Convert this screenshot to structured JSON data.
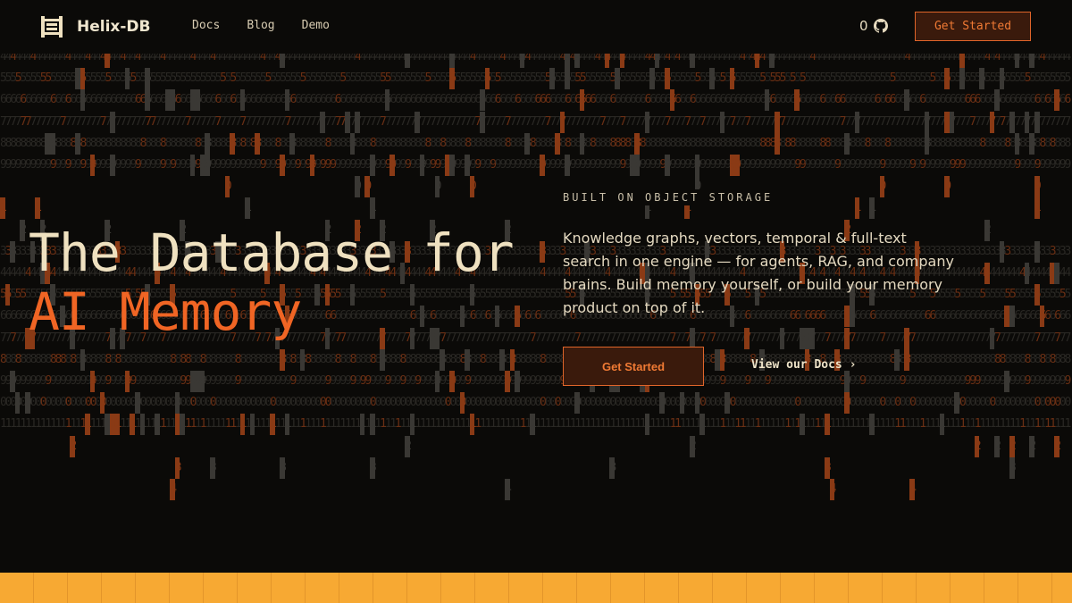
{
  "brand": {
    "name": "Helix-DB",
    "logo_icon": "helix-logo-icon"
  },
  "nav": {
    "items": [
      "Docs",
      "Blog",
      "Demo"
    ]
  },
  "github": {
    "stars": "0",
    "icon": "github-icon"
  },
  "header_cta": {
    "label": "Get Started"
  },
  "hero": {
    "title_line1": "The Database for",
    "title_line2": "AI Memory",
    "eyebrow": "BUILT ON OBJECT STORAGE",
    "description": "Knowledge graphs, vectors, temporal & full-text search in one engine — for agents, RAG, and company brains. Build memory yourself, or build your memory product on top of it.",
    "primary_cta": "Get Started",
    "secondary_cta": "View our Docs",
    "secondary_icon": "chevron-right-icon"
  },
  "background_digits": [
    "4",
    "5",
    "6",
    "7",
    "8",
    "9",
    "0",
    "1",
    "2",
    "3",
    "4",
    "5",
    "6",
    "7",
    "8",
    "9",
    "0",
    "1",
    "2",
    "3",
    "4"
  ],
  "colors": {
    "accent": "#f06524",
    "title": "#efe1c0",
    "background": "#0b0a08",
    "footer_bar": "#f7a933"
  }
}
